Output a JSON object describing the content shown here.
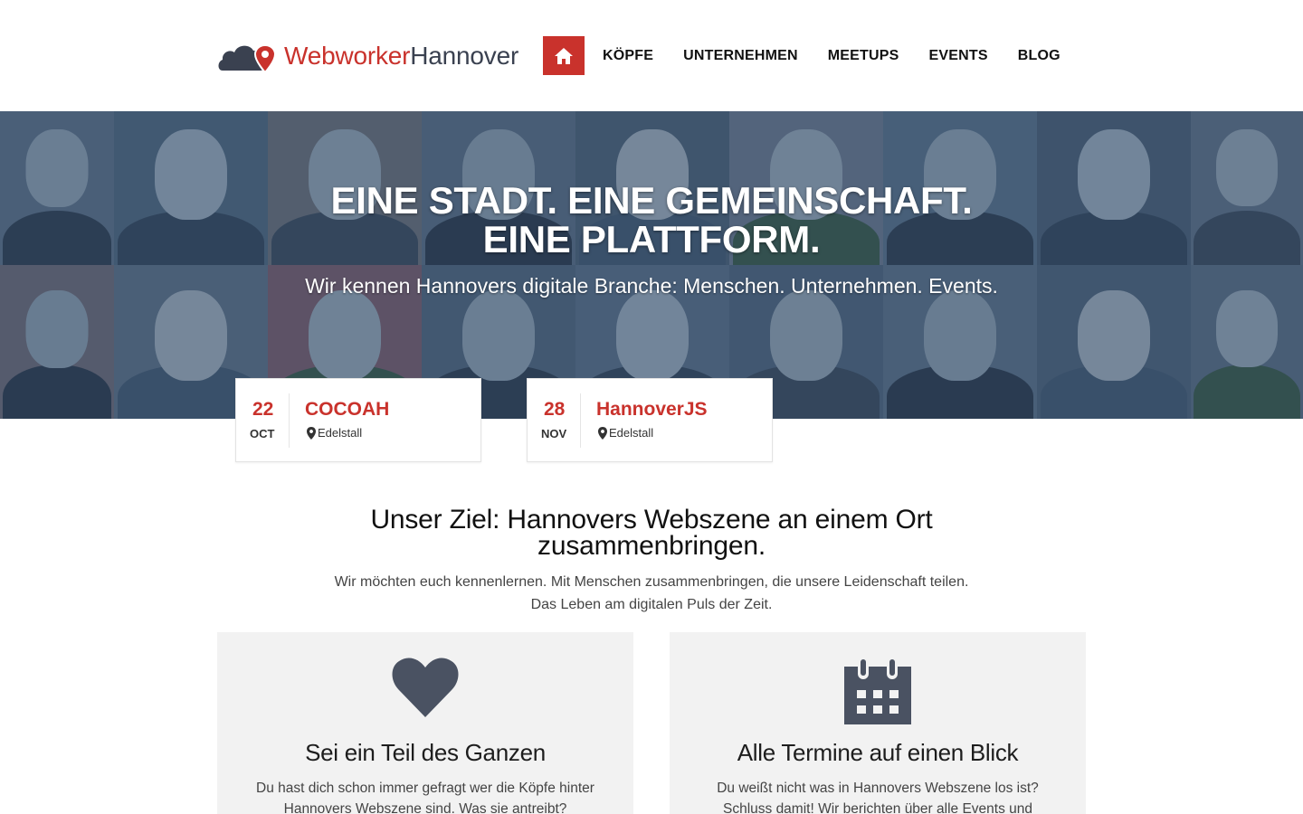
{
  "header": {
    "logo": {
      "part_a": "Webworker",
      "part_b": "Hannover"
    },
    "nav": {
      "home_icon": "home-icon",
      "items": [
        "KÖPFE",
        "UNTERNEHMEN",
        "MEETUPS",
        "EVENTS",
        "BLOG"
      ]
    }
  },
  "hero": {
    "title_line1": "EINE STADT. EINE GEMEINSCHAFT.",
    "title_line2": "EINE PLATTFORM.",
    "subtitle": "Wir kennen Hannovers digitale Branche: Menschen. Unternehmen. Events."
  },
  "events": [
    {
      "day": "22",
      "month": "OCT",
      "name": "COCOAH",
      "location": "Edelstall",
      "location_icon": "map-pin-icon"
    },
    {
      "day": "28",
      "month": "NOV",
      "name": "HannoverJS",
      "location": "Edelstall",
      "location_icon": "map-pin-icon"
    }
  ],
  "intro": {
    "title_line1": "Unser Ziel: Hannovers Webszene an einem Ort",
    "title_line2": "zusammenbringen.",
    "text_line1": "Wir möchten euch kennenlernen. Mit Menschen zusammenbringen, die unsere Leidenschaft teilen.",
    "text_line2": "Das Leben am digitalen Puls der Zeit."
  },
  "features": [
    {
      "icon": "heart-icon",
      "title": "Sei ein Teil des Ganzen",
      "text_line1": "Du hast dich schon immer gefragt wer die Köpfe hinter",
      "text_line2": "Hannovers Webszene sind. Was sie antreibt?"
    },
    {
      "icon": "calendar-icon",
      "title": "Alle Termine auf einen Blick",
      "text_line1": "Du weißt nicht was in Hannovers Webszene los ist?",
      "text_line2": "Schluss damit! Wir berichten über alle Events und"
    }
  ],
  "colors": {
    "brand_red": "#c9322c",
    "logo_dark": "#3a4150",
    "hero_tint": "#3e5267",
    "feature_bg": "#f2f2f2",
    "icon_dark": "#4a5262"
  }
}
